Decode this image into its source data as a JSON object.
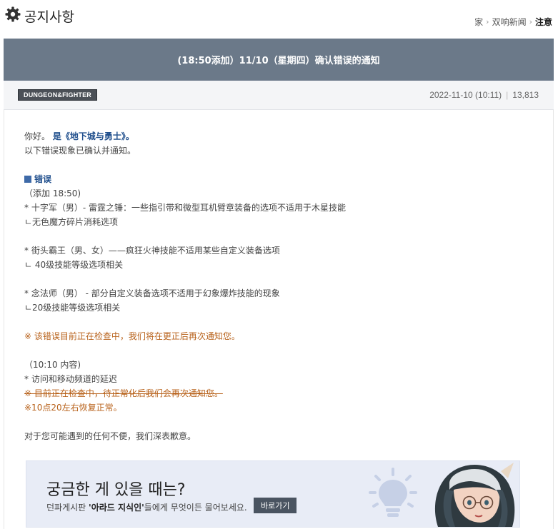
{
  "header": {
    "title": "공지사항",
    "breadcrumb": [
      "家",
      "双响新闻",
      "注意"
    ]
  },
  "banner": {
    "title": "(18:50添加）11/10（星期四）确认错误的通知"
  },
  "meta": {
    "badge": "DUNGEON&FIGHTER",
    "datetime": "2022-11-10 (10:11)",
    "views": "13,813"
  },
  "article": {
    "greeting_prefix": "你好。",
    "greeting_game": "是《地下城与勇士》。",
    "intro": "以下错误现象已确认并通知。",
    "section_title": "错误",
    "added_time": "（添加 18:50)",
    "item1": "* 十字军（男）- 雷霆之锤：一些指引带和微型耳机臂章装备的选项不适用于木星技能",
    "item1_sub": "ㄴ无色魔方碎片消耗选项",
    "item2": "* 街头霸王（男、女）——疯狂火神技能不适用某些自定义装备选项",
    "item2_sub": "ㄴ 40级技能等级选项相关",
    "item3": "* 念法师（男） - 部分自定义装备选项不适用于幻象爆炸技能的现象",
    "item3_sub": "ㄴ20级技能等级选项相关",
    "notice1": "※ 该错误目前正在检查中，我们将在更正后再次通知您。",
    "update_time": "（10:10 内容)",
    "item4": "* 访问和移动频道的延迟",
    "notice2": "※ 目前正在检查中，待正常化后我们会再次通知您。",
    "notice3": "※10点20左右恢复正常。",
    "apology": "对于您可能遇到的任何不便，我们深表歉意。"
  },
  "promo": {
    "headline": "궁금한 게 있을 때는?",
    "desc_prefix": "던파게시판 ",
    "desc_bold": "'아라드 지식인'",
    "desc_suffix": "들에게 무엇이든 물어보세요.",
    "button": "바로가기"
  },
  "colors": {
    "banner_bg": "#6b7989",
    "highlight_blue": "#1f4e8c",
    "notice_orange": "#b8621b",
    "promo_bg": "#e8ecf6"
  },
  "icons": [
    "gear-icon",
    "chevron-right-icon",
    "lightbulb-icon",
    "character-illustration"
  ]
}
